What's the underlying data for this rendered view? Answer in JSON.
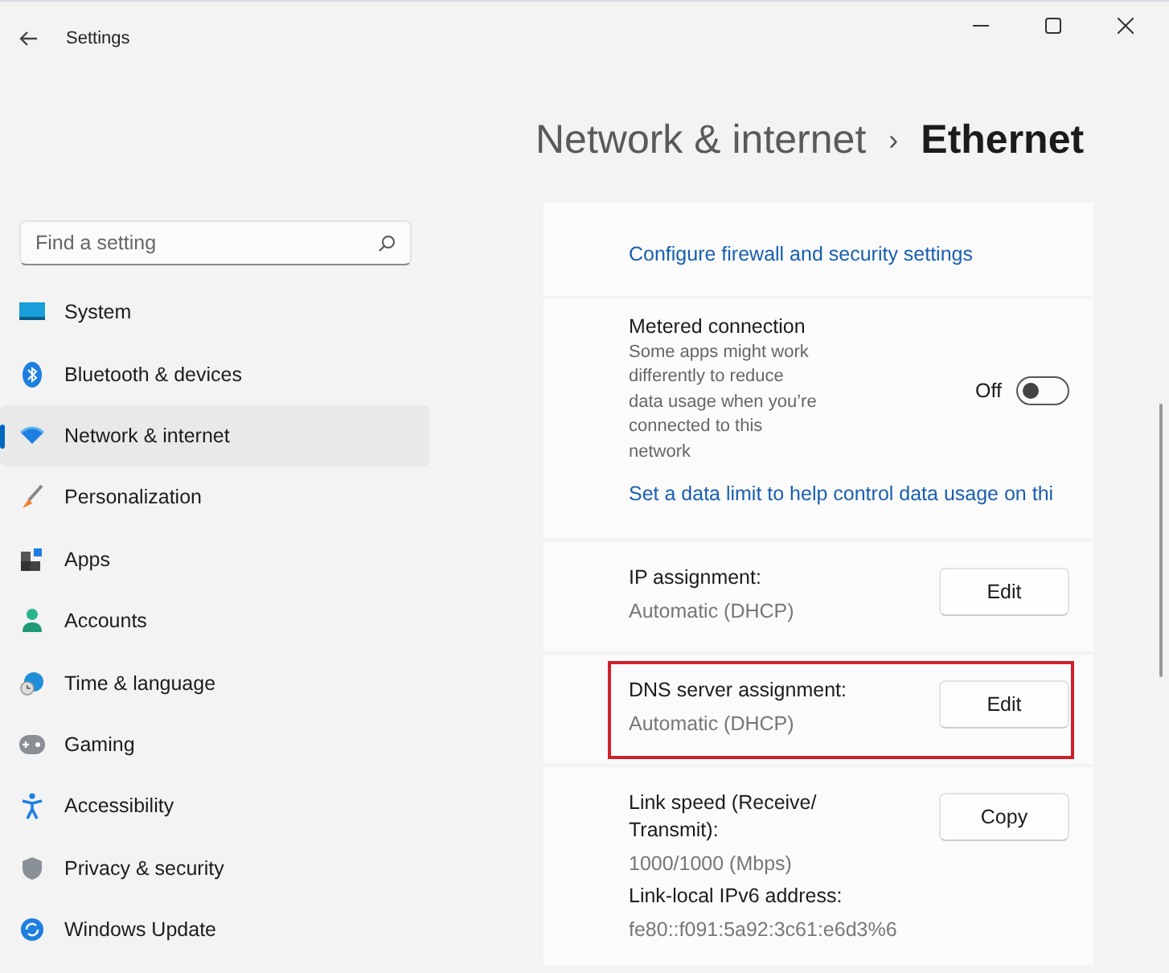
{
  "window": {
    "title": "Settings"
  },
  "breadcrumb": {
    "parent": "Network & internet",
    "separator": "›",
    "current": "Ethernet"
  },
  "search": {
    "placeholder": "Find a setting"
  },
  "sidebar": {
    "items": [
      {
        "label": "System",
        "selected": false
      },
      {
        "label": "Bluetooth & devices",
        "selected": false
      },
      {
        "label": "Network & internet",
        "selected": true
      },
      {
        "label": "Personalization",
        "selected": false
      },
      {
        "label": "Apps",
        "selected": false
      },
      {
        "label": "Accounts",
        "selected": false
      },
      {
        "label": "Time & language",
        "selected": false
      },
      {
        "label": "Gaming",
        "selected": false
      },
      {
        "label": "Accessibility",
        "selected": false
      },
      {
        "label": "Privacy & security",
        "selected": false
      },
      {
        "label": "Windows Update",
        "selected": false
      }
    ]
  },
  "cards": [
    {
      "items": [
        {
          "kind": "link",
          "text": "Configure firewall and security settings"
        }
      ]
    },
    {
      "items": [
        {
          "kind": "toggle",
          "title": "Metered connection",
          "description": "Some apps might work differently to reduce data usage when you’re connected to this network",
          "state_label": "Off",
          "on": false
        },
        {
          "kind": "link",
          "text": "Set a data limit to help control data usage on thi"
        }
      ]
    },
    {
      "items": [
        {
          "kind": "property",
          "button": "Edit",
          "highlighted": false,
          "fields": [
            {
              "label": "IP assignment:",
              "value": "Automatic (DHCP)"
            }
          ]
        }
      ]
    },
    {
      "items": [
        {
          "kind": "property",
          "button": "Edit",
          "highlighted": true,
          "fields": [
            {
              "label": "DNS server assignment:",
              "value": "Automatic (DHCP)"
            }
          ]
        }
      ]
    },
    {
      "items": [
        {
          "kind": "property",
          "button": "Copy",
          "highlighted": false,
          "fields": [
            {
              "label": "Link speed (Receive/ Transmit):",
              "value": "1000/1000 (Mbps)"
            },
            {
              "label": "Link-local IPv6 address:",
              "value": "fe80::f091:5a92:3c61:e6d3%6"
            }
          ]
        }
      ]
    }
  ]
}
